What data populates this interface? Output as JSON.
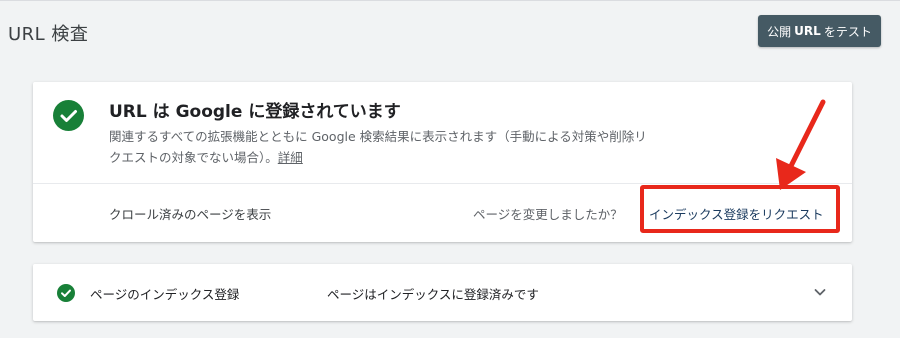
{
  "header": {
    "title": "URL 検査",
    "test_button_prefix": "公開",
    "test_button_bold": "URL",
    "test_button_suffix": "をテスト"
  },
  "status_card": {
    "title": "URL は Google に登録されています",
    "description": "関連するすべての拡張機能とともに Google 検索結果に表示されます（手動による対策や削除リクエストの対象でない場合）。",
    "details_link": "詳細",
    "crawled_page_link": "クロール済みのページを表示",
    "changed_question": "ページを変更しましたか？",
    "request_index_link": "インデックス登録をリクエスト"
  },
  "coverage_card": {
    "label": "ページのインデックス登録",
    "value": "ページはインデックスに登録済みです"
  },
  "colors": {
    "success_green": "#188038",
    "annotation_red": "#e8281b",
    "button_bg": "#455a64"
  },
  "icons": {
    "status": "check-circle-icon",
    "expand": "chevron-down-icon",
    "annotation": "red-arrow-icon"
  }
}
